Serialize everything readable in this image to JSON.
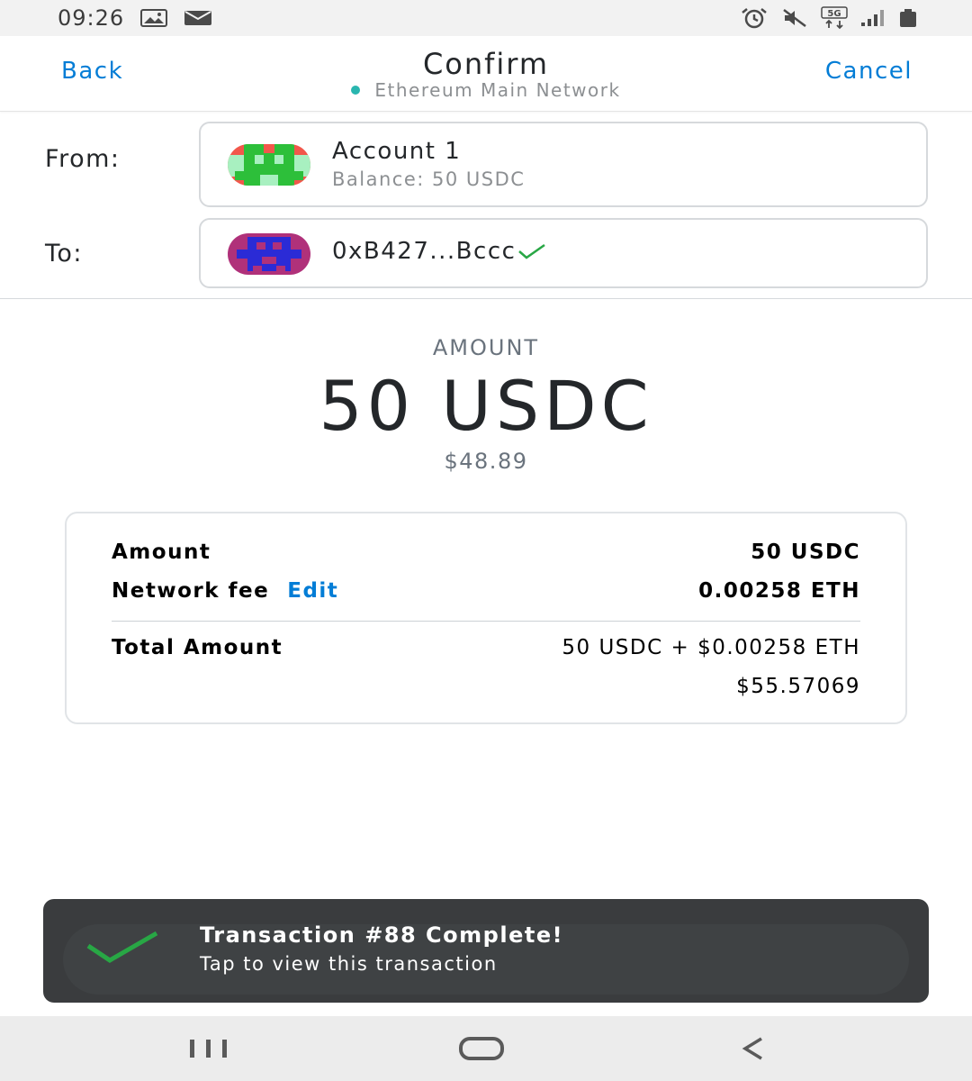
{
  "status_bar": {
    "time": "09:26",
    "left_icons": [
      "image-icon",
      "message-icon"
    ],
    "right_icons": [
      "alarm-icon",
      "mute-icon",
      "5g-icon",
      "signal-icon",
      "battery-icon"
    ],
    "network_badge": "5G"
  },
  "header": {
    "back_label": "Back",
    "title": "Confirm",
    "network": "Ethereum Main Network",
    "cancel_label": "Cancel",
    "accent_color": "#037dd6",
    "network_dot_color": "#29b6af"
  },
  "from": {
    "label": "From:",
    "account_name": "Account 1",
    "balance": "Balance: 50 USDC"
  },
  "to": {
    "label": "To:",
    "address": "0xB427...Bccc",
    "verified_icon": "check-icon"
  },
  "amount": {
    "label": "AMOUNT",
    "value": "50 USDC",
    "fiat": "$48.89"
  },
  "summary": {
    "amount_key": "Amount",
    "amount_val": "50 USDC",
    "fee_key": "Network fee",
    "fee_edit": "Edit",
    "fee_val": "0.00258 ETH",
    "total_key": "Total Amount",
    "total_val": "50 USDC + $0.00258 ETH",
    "total_fiat": "$55.57069"
  },
  "toast": {
    "title": "Transaction #88 Complete!",
    "subtitle": "Tap to view this transaction",
    "check_color": "#28a745"
  },
  "nav": {
    "icons": [
      "recent-apps-icon",
      "home-icon",
      "back-icon"
    ]
  }
}
